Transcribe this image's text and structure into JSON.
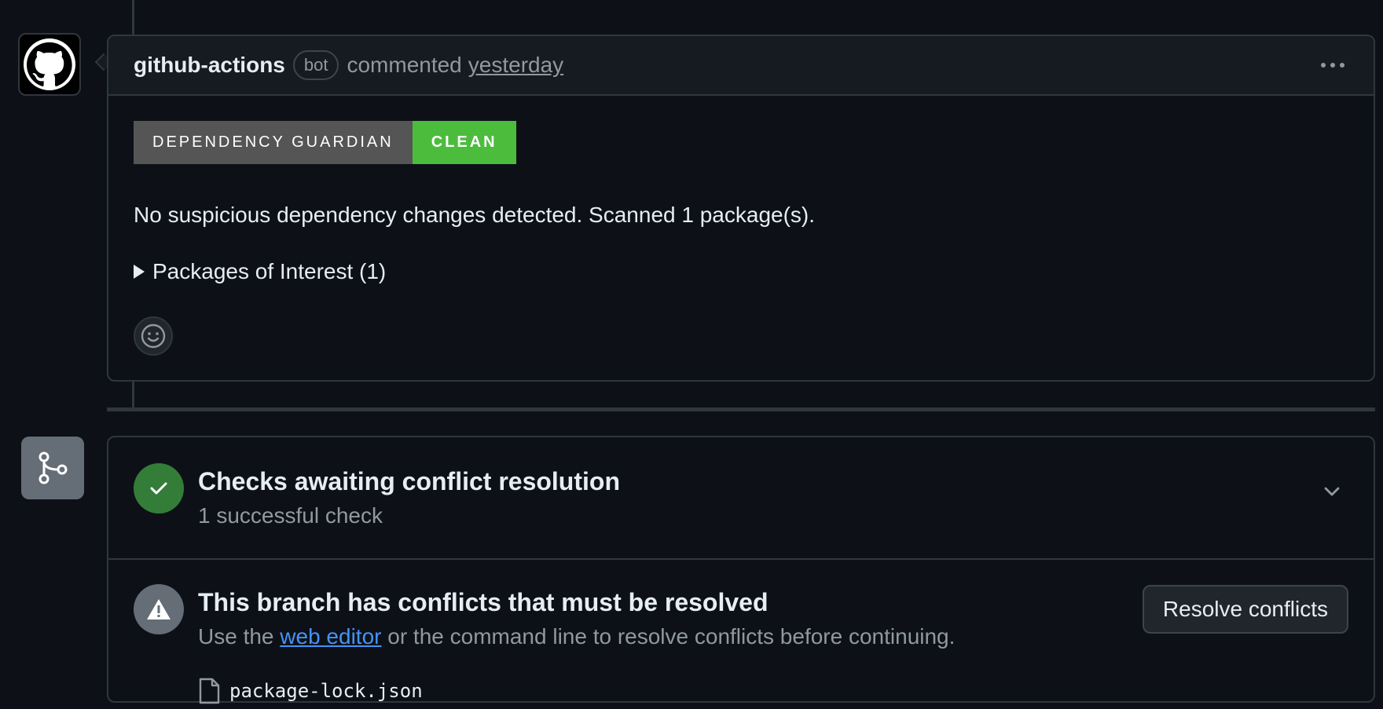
{
  "comment": {
    "author": "github-actions",
    "bot_label": "bot",
    "action": "commented",
    "time": "yesterday",
    "badge": {
      "label": "DEPENDENCY GUARDIAN",
      "status": "CLEAN",
      "status_color": "#4cbc3c"
    },
    "body": "No suspicious dependency changes detected. Scanned 1 package(s).",
    "details_summary": "Packages of Interest (1)",
    "icons": {
      "more": "kebab-horizontal-icon",
      "emoji": "smiley-icon",
      "avatar": "github-logo-icon"
    }
  },
  "merge": {
    "checks": {
      "title": "Checks awaiting conflict resolution",
      "subtitle": "1 successful check",
      "status_color": "#347d39",
      "icon": "check-icon"
    },
    "conflicts": {
      "title": "This branch has conflicts that must be resolved",
      "text_before": "Use the",
      "link_text": "web editor",
      "text_after": "or the command line to resolve conflicts before continuing.",
      "button_label": "Resolve conflicts",
      "icon": "alert-icon",
      "files": [
        "package-lock.json"
      ]
    }
  }
}
